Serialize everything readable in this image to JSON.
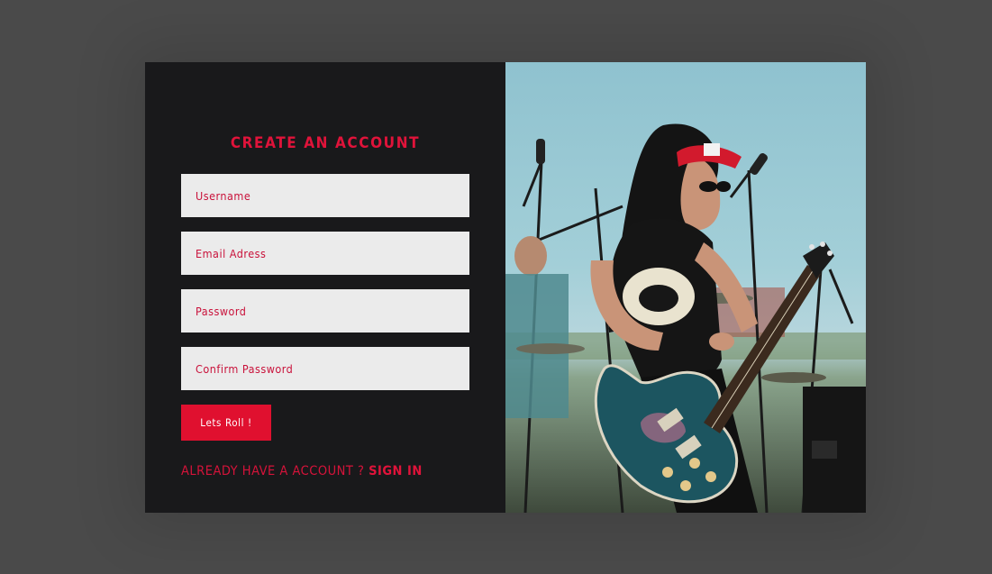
{
  "form": {
    "title": "CREATE AN ACCOUNT",
    "fields": [
      {
        "placeholder": "Username"
      },
      {
        "placeholder": "Email Adress"
      },
      {
        "placeholder": "Password"
      },
      {
        "placeholder": "Confirm Password"
      }
    ],
    "submit_label": "Lets Roll !",
    "signin_question": "ALREADY HAVE A ACCOUNT ?",
    "signin_link": "SIGN IN"
  },
  "photo": {
    "alt_subject": "guitarist-on-stage"
  },
  "colors": {
    "accent": "#e0133a",
    "panel": "#19191b",
    "backdrop": "#4a4a4a",
    "input_bg": "#ebebeb"
  }
}
